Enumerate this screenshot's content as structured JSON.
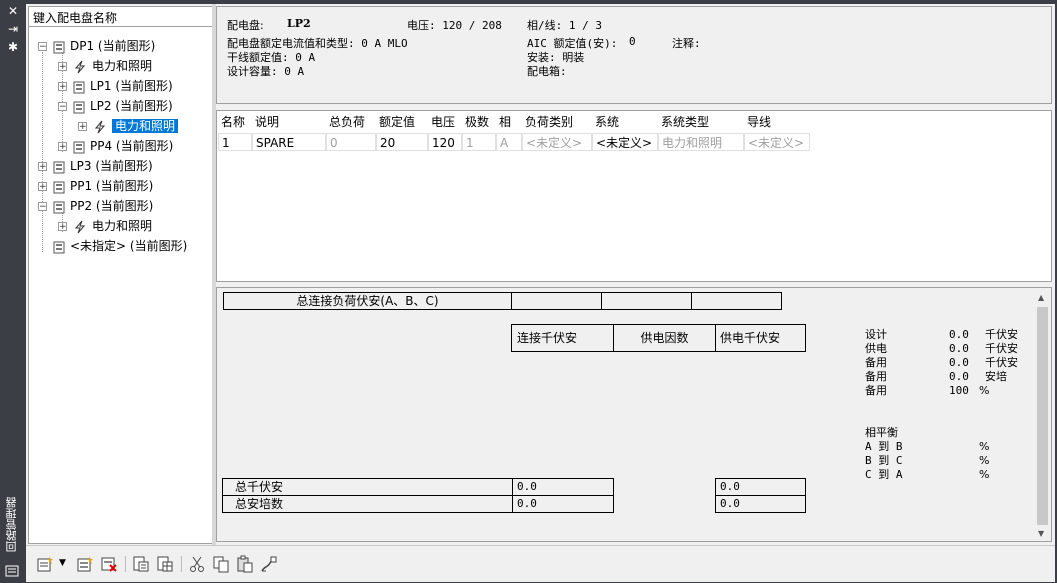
{
  "palette": {
    "title": "回路管理器",
    "close_glyph": "✕",
    "autohide_glyph": "⇥",
    "properties_glyph": "✱"
  },
  "tree": {
    "search_placeholder": "键入配电盘名称",
    "items": [
      {
        "label": "DP1 (当前图形)",
        "type": "panel",
        "expanded": true
      },
      {
        "label": "电力和照明",
        "type": "system"
      },
      {
        "label": "LP1 (当前图形)",
        "type": "panel"
      },
      {
        "label": "LP2 (当前图形)",
        "type": "panel",
        "expanded": true
      },
      {
        "label": "电力和照明",
        "type": "system",
        "selected": true
      },
      {
        "label": "PP4 (当前图形)",
        "type": "panel"
      },
      {
        "label": "LP3 (当前图形)",
        "type": "panel"
      },
      {
        "label": "PP1 (当前图形)",
        "type": "panel"
      },
      {
        "label": "PP2 (当前图形)",
        "type": "panel",
        "expanded": true
      },
      {
        "label": "电力和照明",
        "type": "system"
      },
      {
        "label": "<未指定> (当前图形)",
        "type": "panel"
      }
    ]
  },
  "header": {
    "panel_label": "配电盘:",
    "panel_value": "LP2",
    "voltage_label": "电压: 120 / 208",
    "phase_label": "相/线: 1 / 3",
    "rating_label": "配电盘额定电流值和类型: 0 A MLO",
    "aic_label": "AIC 额定值(安):",
    "aic_value": "0",
    "notes_label": "注释:",
    "feeder_label": "干线额定值: 0 A",
    "mounting_label": "安装: 明装",
    "design_label": "设计容量: 0 A",
    "enclosure_label": "配电箱:"
  },
  "grid": {
    "columns": [
      "名称",
      "说明",
      "总负荷",
      "额定值",
      "电压",
      "极数",
      "相",
      "负荷类别",
      "系统",
      "系统类型",
      "导线"
    ],
    "rows": [
      [
        "1",
        "SPARE",
        "0",
        "20",
        "120",
        "1",
        "A",
        "<未定义>",
        "<未定义>",
        "电力和照明",
        "<未定义>"
      ]
    ]
  },
  "summary": {
    "total_connected_label": "总连接负荷伏安(A、B、C)",
    "connected_kva_header": "连接千伏安",
    "demand_factor_header": "供电因数",
    "demand_kva_header": "供电千伏安",
    "total_kva_label": "总千伏安",
    "total_kva_value": "0.0",
    "total_kva_demand": "0.0",
    "total_amps_label": "总安培数",
    "total_amps_value": "0.0",
    "total_amps_demand": "0.0",
    "stats": [
      {
        "label": "设计",
        "value": "0.0",
        "unit": "千伏安"
      },
      {
        "label": "供电",
        "value": "0.0",
        "unit": "千伏安"
      },
      {
        "label": "备用",
        "value": "0.0",
        "unit": "千伏安"
      },
      {
        "label": "备用",
        "value": "0.0",
        "unit": "安培"
      },
      {
        "label": "备用",
        "value": "100",
        "unit": "%"
      }
    ],
    "balance_title": "相平衡",
    "balance": [
      {
        "label": "A 到 B",
        "unit": "%"
      },
      {
        "label": "B 到 C",
        "unit": "%"
      },
      {
        "label": "C 到 A",
        "unit": "%"
      }
    ]
  },
  "toolbar": {
    "buttons": [
      "new-panel-icon",
      "dropdown-arrow-icon",
      "new-circuit-icon",
      "delete-circuit-icon",
      "panel-schedule-icon",
      "panel-schedule-table-icon",
      "cut-icon",
      "copy-icon",
      "paste-icon",
      "wire-icon"
    ]
  },
  "colors": {
    "selection": "#0078d7",
    "background": "#f0f0f0",
    "chrome": "#3b3f45"
  }
}
